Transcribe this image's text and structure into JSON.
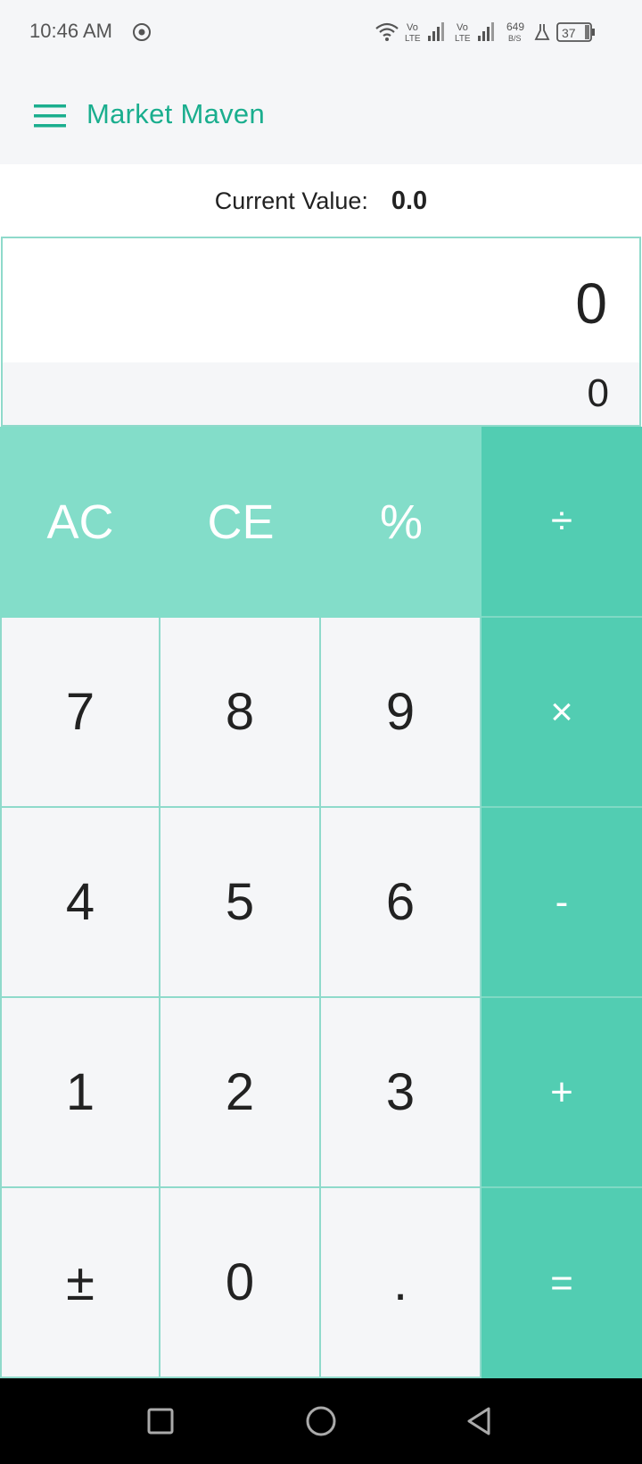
{
  "status_bar": {
    "time": "10:46 AM",
    "net_speed_value": "649",
    "net_speed_unit": "B/S",
    "battery": "37",
    "volte_1": "Vo",
    "volte_1b": "LTE",
    "volte_2": "Vo",
    "volte_2b": "LTE"
  },
  "app_bar": {
    "title": "Market Maven",
    "accent_color": "#1aae8e"
  },
  "current_value": {
    "label": "Current Value:",
    "value": "0.0"
  },
  "display": {
    "main": "0",
    "secondary": "0"
  },
  "keypad": {
    "row1": [
      "AC",
      "CE",
      "%",
      "÷"
    ],
    "row2": [
      "7",
      "8",
      "9",
      "×"
    ],
    "row3": [
      "4",
      "5",
      "6",
      "-"
    ],
    "row4": [
      "1",
      "2",
      "3",
      "+"
    ],
    "row5": [
      "±",
      "0",
      ".",
      "="
    ]
  },
  "colors": {
    "operator": "#52cdb2",
    "function": "#83ddc9",
    "digit_bg": "#f5f6f8",
    "border": "#8fdacb"
  },
  "nav_bar": {
    "icons": [
      "recents-square-icon",
      "home-circle-icon",
      "back-triangle-icon"
    ]
  }
}
